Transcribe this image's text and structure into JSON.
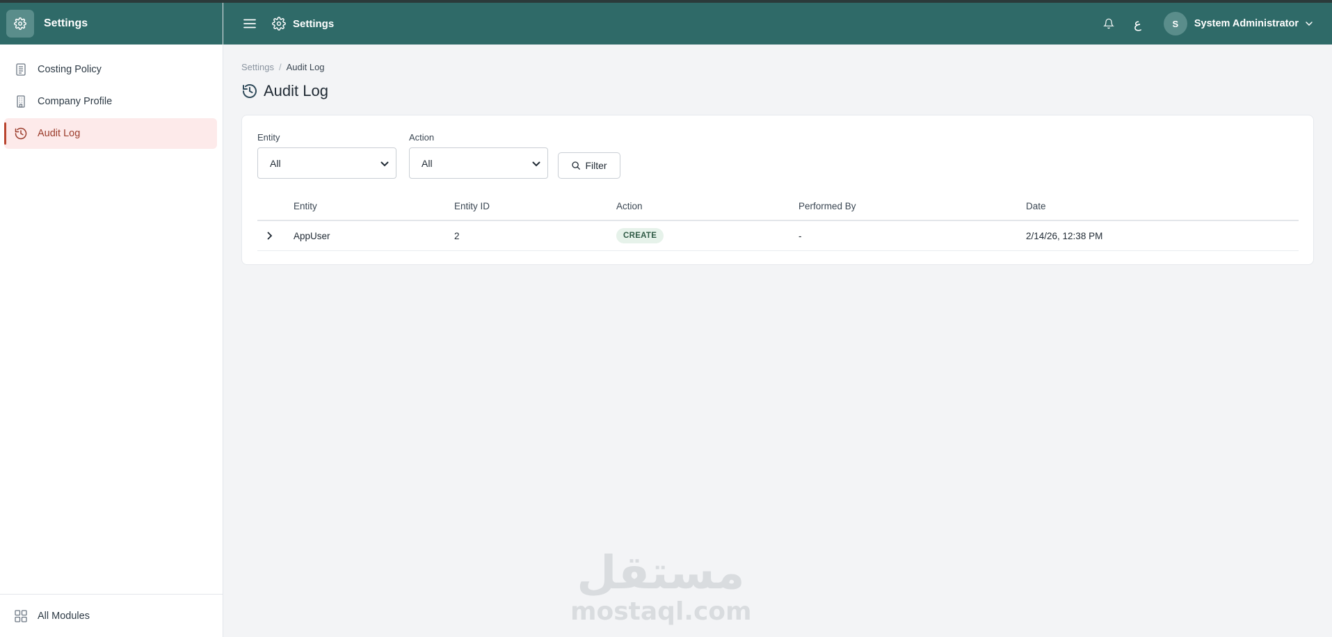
{
  "sidebar": {
    "title": "Settings",
    "header_icon": "gear-icon",
    "items": [
      {
        "label": "Costing Policy",
        "icon": "document-icon",
        "active": false
      },
      {
        "label": "Company Profile",
        "icon": "building-icon",
        "active": false
      },
      {
        "label": "Audit Log",
        "icon": "history-icon",
        "active": true
      }
    ],
    "footer": {
      "label": "All Modules",
      "icon": "grid-icon"
    }
  },
  "topbar": {
    "title": "Settings",
    "menu_icon": "hamburger-icon",
    "notification_icon": "bell-icon",
    "language_label": "ع",
    "user": {
      "avatar_initial": "S",
      "name": "System Administrator"
    }
  },
  "breadcrumb": {
    "root": "Settings",
    "separator": "/",
    "current": "Audit Log"
  },
  "page": {
    "title": "Audit Log",
    "icon": "history-icon"
  },
  "filters": {
    "entity": {
      "label": "Entity",
      "value": "All"
    },
    "action": {
      "label": "Action",
      "value": "All"
    },
    "button_label": "Filter"
  },
  "table": {
    "columns": [
      "Entity",
      "Entity ID",
      "Action",
      "Performed By",
      "Date"
    ],
    "rows": [
      {
        "entity": "AppUser",
        "entity_id": "2",
        "action": "CREATE",
        "performed_by": "-",
        "date": "2/14/26, 12:38 PM"
      }
    ]
  },
  "colors": {
    "header_bg": "#2f6a68",
    "active_item_bg": "#fdeaea",
    "active_accent": "#b9442e",
    "badge_bg": "#e6f2ea"
  },
  "watermark": {
    "arabic": "مستقل",
    "latin": "mostaql.com"
  }
}
